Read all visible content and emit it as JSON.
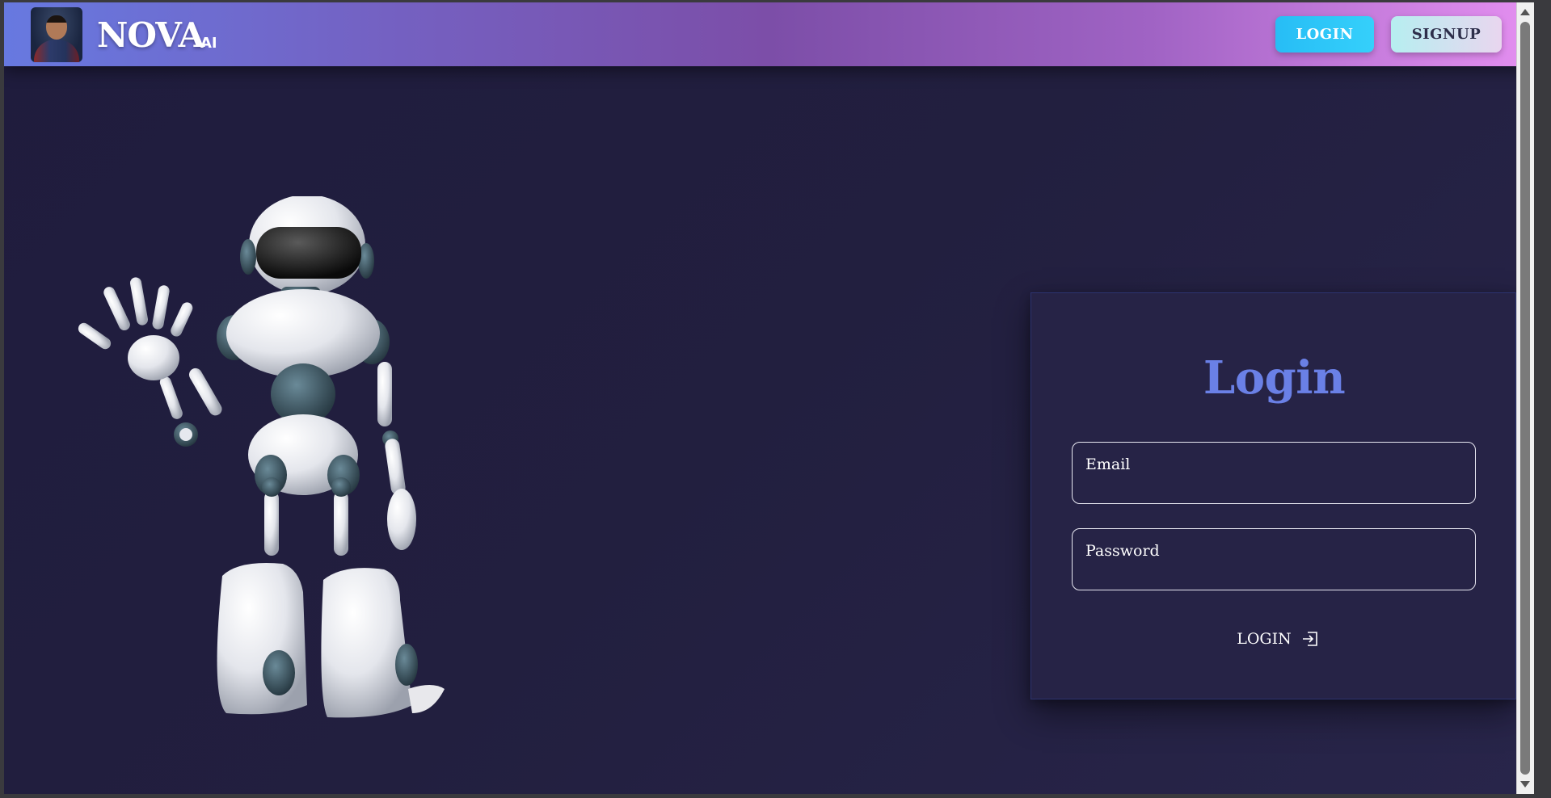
{
  "navbar": {
    "brand": "NOVA",
    "brand_suffix": "AI",
    "login_label": "LOGIN",
    "signup_label": "SIGNUP",
    "gradient_colors": [
      "#6779e0",
      "#7c4ea8",
      "#e48ff0"
    ]
  },
  "login_card": {
    "title": "Login",
    "email_placeholder": "Email",
    "password_placeholder": "Password",
    "submit_label": "LOGIN",
    "submit_icon": "login-arrow-icon",
    "title_color": "#6a80e6"
  },
  "hero": {
    "illustration": "waving-robot"
  },
  "colors": {
    "background": "#221f3f",
    "card": "#262346",
    "login_button": "#27bdf5",
    "signup_button": "#b6eef0"
  }
}
